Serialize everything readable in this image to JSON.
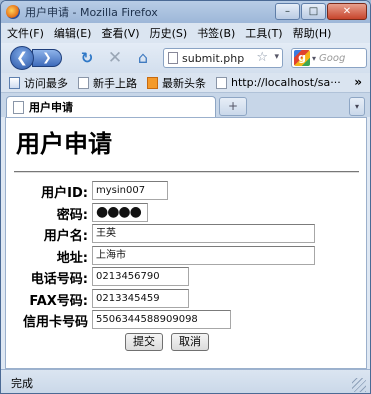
{
  "window": {
    "title": "用户申请 - Mozilla Firefox",
    "controls": {
      "minimize": "–",
      "maximize": "□",
      "close": "✕"
    }
  },
  "menu": [
    "文件(F)",
    "编辑(E)",
    "查看(V)",
    "历史(S)",
    "书签(B)",
    "工具(T)",
    "帮助(H)"
  ],
  "nav": {
    "back_icon": "❮",
    "forward_icon": "❯",
    "reload_icon": "↻",
    "stop_icon": "✕",
    "home_icon": "⌂",
    "url": "submit.php",
    "star_icon": "☆",
    "url_dropdown_icon": "▾",
    "search_engine": "g",
    "search_dropdown": "▾",
    "search_placeholder": "Goog"
  },
  "bookmarks": [
    "访问最多",
    "新手上路",
    "最新头条",
    "http://localhost/sa···"
  ],
  "bookmarks_more": "»",
  "tabs": [
    {
      "label": "用户申请"
    }
  ],
  "new_tab_label": "+",
  "tab_list_label": "▾",
  "page": {
    "heading": "用户申请",
    "fields": {
      "userid": {
        "label": "用户ID:",
        "value": "mysin007"
      },
      "password": {
        "label": "密码:",
        "value": "●●●●"
      },
      "username": {
        "label": "用户名:",
        "value": "王英"
      },
      "address": {
        "label": "地址:",
        "value": "上海市"
      },
      "phone": {
        "label": "电话号码:",
        "value": "0213456790"
      },
      "fax": {
        "label": "FAX号码:",
        "value": "0213345459"
      },
      "card": {
        "label": "信用卡号码",
        "value": "5506344588909098"
      }
    },
    "submit_label": "提交",
    "cancel_label": "取消"
  },
  "status": {
    "text": "完成"
  }
}
